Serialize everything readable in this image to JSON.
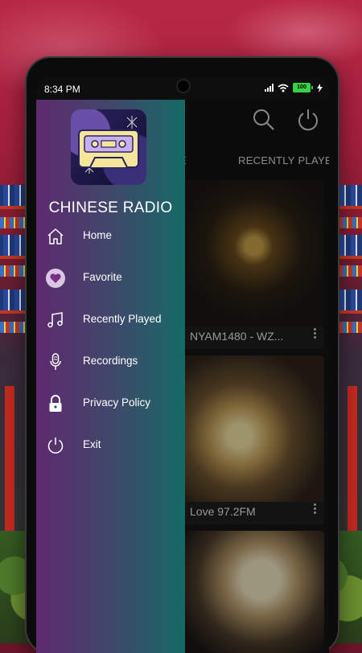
{
  "status_bar": {
    "time": "8:34 PM",
    "battery": "100"
  },
  "drawer": {
    "app_name": "CHINESE RADIO",
    "menu": [
      {
        "label": "Home",
        "icon": "home-icon"
      },
      {
        "label": "Favorite",
        "icon": "heart-icon"
      },
      {
        "label": "Recently Played",
        "icon": "music-note-icon"
      },
      {
        "label": "Recordings",
        "icon": "microphone-icon"
      },
      {
        "label": "Privacy Policy",
        "icon": "lock-icon"
      },
      {
        "label": "Exit",
        "icon": "power-icon"
      }
    ]
  },
  "main": {
    "tabs": [
      "E",
      "RECENTLY PLAYE"
    ],
    "stations": [
      {
        "name": "NYAM1480 - WZ..."
      },
      {
        "name": "Love 97.2FM"
      },
      {
        "name": ""
      }
    ]
  },
  "colors": {
    "drawer_start": "#5e2a6e",
    "drawer_end": "#146a64",
    "battery": "#37d046"
  }
}
